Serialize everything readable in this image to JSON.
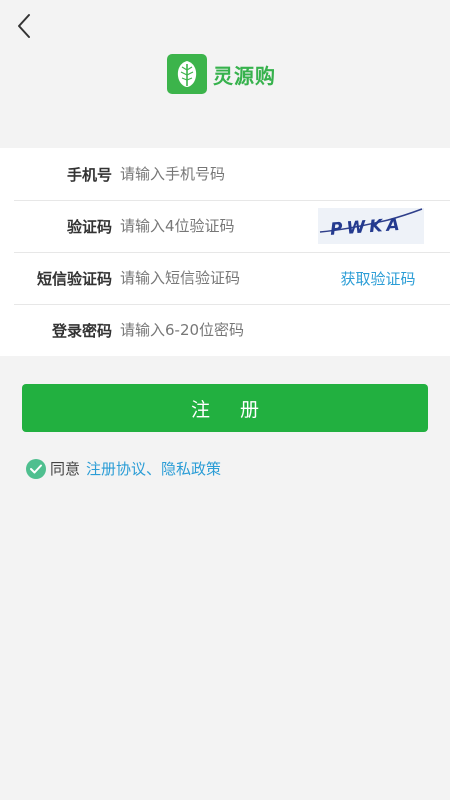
{
  "app": {
    "name": "灵源购",
    "brand_color": "#22b040",
    "link_color": "#2b9dd6"
  },
  "nav": {
    "back_icon": "chevron-left-icon"
  },
  "form": {
    "phone": {
      "label": "手机号",
      "placeholder": "请输入手机号码"
    },
    "captcha": {
      "label": "验证码",
      "placeholder": "请输入4位验证码",
      "image_text": "PWKA"
    },
    "sms": {
      "label": "短信验证码",
      "placeholder": "请输入短信验证码",
      "button": "获取验证码"
    },
    "password": {
      "label": "登录密码",
      "placeholder": "请输入6-20位密码"
    }
  },
  "register_button": "注 册",
  "agreement": {
    "prefix": "同意",
    "terms_link": "注册协议",
    "separator": "、",
    "privacy_link": "隐私政策",
    "checked": true
  }
}
